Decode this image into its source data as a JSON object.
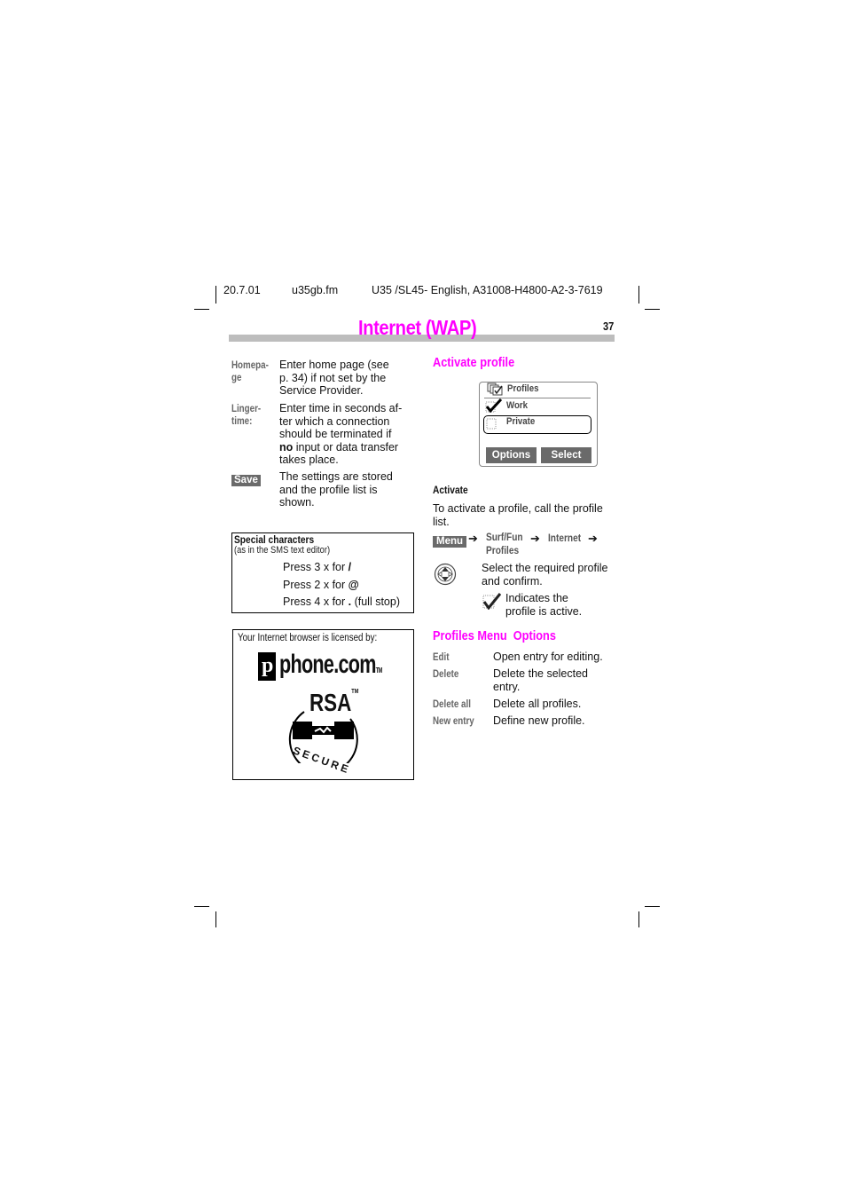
{
  "header": {
    "date": "20.7.01",
    "file": "u35gb.fm",
    "doc_id": "U35 /SL45- English, A31008-H4800-A2-3-7619"
  },
  "page": {
    "title": "Internet (WAP)",
    "number": "37"
  },
  "left": {
    "definitions": [
      {
        "term_line1": "Homepa-",
        "term_line2": "ge",
        "desc_lines": [
          "Enter home page (see",
          "p. 34) if not set by the",
          "Service Provider."
        ]
      },
      {
        "term_line1": "Linger-",
        "term_line2": "time:",
        "desc_lines": [
          "Enter time in seconds af-",
          "ter which a connection",
          "should be terminated if"
        ],
        "desc_bold": "no",
        "desc_after_bold": " input or data transfer",
        "desc_last": "takes place."
      }
    ],
    "save": {
      "key": "Save",
      "desc_lines": [
        "The settings are stored",
        "and the profile list is",
        "shown."
      ]
    },
    "special_chars": {
      "title": "Special characters",
      "subtitle": "(as in the SMS text editor)",
      "rows": [
        {
          "text": "Press 3 x for ",
          "char": "/",
          "suffix": ""
        },
        {
          "text": "Press 2 x for ",
          "char": "@",
          "suffix": ""
        },
        {
          "text": "Press 4 x for ",
          "char": ".",
          "suffix": " (full stop)"
        }
      ]
    },
    "license": {
      "caption": "Your Internet browser is licensed by:",
      "logo1": "phone.com",
      "logo1_tm": "TM",
      "logo2": "RSA",
      "logo2_tm": "TM",
      "logo2_ring": "SECURE"
    }
  },
  "right": {
    "activate_heading": "Activate profile",
    "phone_screen": {
      "title": "Profiles",
      "items": [
        {
          "label": "Work",
          "active": true
        },
        {
          "label": "Private",
          "active": false,
          "selected": true
        }
      ],
      "softkeys": {
        "left": "Options",
        "right": "Select"
      }
    },
    "activate_subheading": "Activate",
    "activate_text_lines": [
      "To activate a profile, call the profile",
      "list."
    ],
    "nav_path": {
      "menu_key": "Menu",
      "arrow": "➔",
      "steps": [
        "Surf/Fun",
        "Internet",
        "Profiles"
      ]
    },
    "select_text_lines": [
      "Select the required profile",
      "and confirm."
    ],
    "indicates_text_lines": [
      "Indicates the",
      "profile is active."
    ],
    "options_heading": "Profiles Menu  Options",
    "options": [
      {
        "term": "Edit",
        "desc_lines": [
          "Open entry for editing."
        ]
      },
      {
        "term": "Delete",
        "desc_lines": [
          "Delete the selected",
          "entry."
        ]
      },
      {
        "term": "Delete all",
        "desc_lines": [
          "Delete all profiles."
        ]
      },
      {
        "term": "New entry",
        "desc_lines": [
          "Define new profile."
        ]
      }
    ]
  }
}
